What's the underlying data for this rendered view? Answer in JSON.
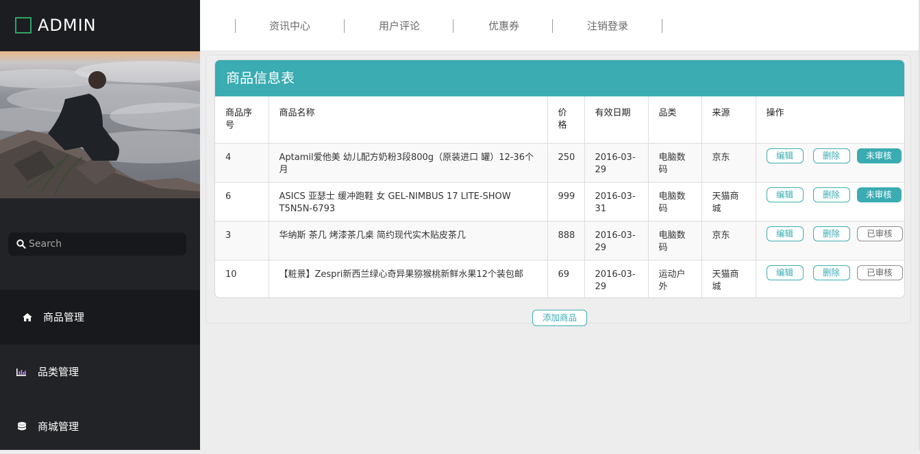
{
  "brand": {
    "title": "ADMIN"
  },
  "sidebar": {
    "search": {
      "placeholder": "Search",
      "value": ""
    },
    "items": [
      {
        "label": "商品管理",
        "icon": "home-icon",
        "active": true
      },
      {
        "label": "品类管理",
        "icon": "bar-chart-icon",
        "active": false
      },
      {
        "label": "商城管理",
        "icon": "database-icon",
        "active": false
      }
    ]
  },
  "topnav": {
    "links": [
      {
        "label": "资讯中心"
      },
      {
        "label": "用户评论"
      },
      {
        "label": "优惠券"
      },
      {
        "label": "注销登录"
      }
    ]
  },
  "panel": {
    "title": "商品信息表",
    "columns": [
      "商品序号",
      "商品名称",
      "价格",
      "有效日期",
      "品类",
      "来源",
      "操作"
    ],
    "rows": [
      {
        "id": "4",
        "name": "Aptamil爱他美 幼儿配方奶粉3段800g（原装进口 罐）12-36个月",
        "price": "250",
        "date": "2016-03-29",
        "category": "电脑数码",
        "source": "京东",
        "edit": "编辑",
        "delete": "删除",
        "status": "未审核",
        "reviewed": false
      },
      {
        "id": "6",
        "name": "ASICS 亚瑟士 缓冲跑鞋 女 GEL-NIMBUS 17 LITE-SHOW T5N5N-6793",
        "price": "999",
        "date": "2016-03-31",
        "category": "电脑数码",
        "source": "天猫商城",
        "edit": "编辑",
        "delete": "删除",
        "status": "未审核",
        "reviewed": false
      },
      {
        "id": "3",
        "name": "华纳斯 茶几 烤漆茶几桌 简约现代实木贴皮茶几",
        "price": "888",
        "date": "2016-03-29",
        "category": "电脑数码",
        "source": "京东",
        "edit": "编辑",
        "delete": "删除",
        "status": "已审核",
        "reviewed": true
      },
      {
        "id": "10",
        "name": "【粧景】Zespri新西兰绿心奇异果猕猴桃新鲜水果12个装包邮",
        "price": "69",
        "date": "2016-03-29",
        "category": "运动户外",
        "source": "天猫商城",
        "edit": "编辑",
        "delete": "删除",
        "status": "已审核",
        "reviewed": true
      }
    ],
    "add_label": "添加商品"
  },
  "colors": {
    "accent": "#3aacb2",
    "sidebar": "#222327",
    "brand_box": "#2fa566"
  }
}
